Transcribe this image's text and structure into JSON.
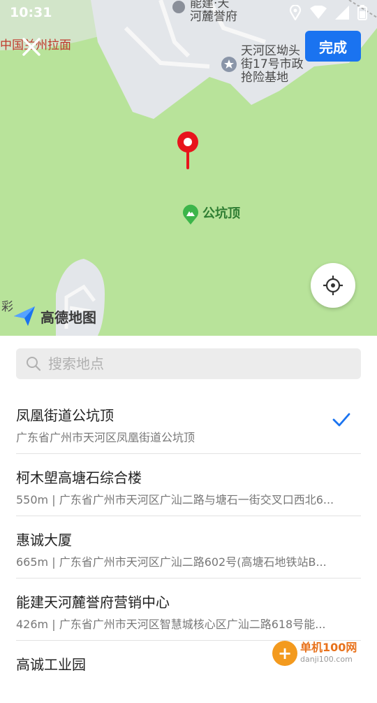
{
  "status": {
    "time": "10:31"
  },
  "map": {
    "labels": {
      "top_poi": "能建·天\n河麓誉府",
      "left_poi": "中国兰州拉面",
      "right_poi": "天河区坳头\n街17号市政\n抢险基地",
      "summit": "公坑顶",
      "left_edge": "彩"
    },
    "logo_text": "高德地图"
  },
  "toolbar": {
    "done_label": "完成"
  },
  "search": {
    "placeholder": "搜索地点",
    "value": ""
  },
  "results": [
    {
      "name": "凤凰街道公坑顶",
      "address": "广东省广州市天河区凤凰街道公坑顶",
      "selected": true
    },
    {
      "name": "柯木塱高塘石综合楼",
      "address": "550m | 广东省广州市天河区广汕二路与塘石一街交叉口西北6...",
      "selected": false
    },
    {
      "name": "惠诚大厦",
      "address": "665m | 广东省广州市天河区广汕二路602号(高塘石地铁站B...",
      "selected": false
    },
    {
      "name": "能建天河麓誉府营销中心",
      "address": "426m | 广东省广州市天河区智慧城核心区广汕二路618号能...",
      "selected": false
    },
    {
      "name": "高诚工业园",
      "address": "",
      "selected": false
    }
  ],
  "watermark": {
    "title": "单机100网",
    "url": "danji100.com"
  },
  "colors": {
    "accent": "#1a73f0",
    "map_green": "#b8e39a",
    "pin": "#e8141c"
  }
}
